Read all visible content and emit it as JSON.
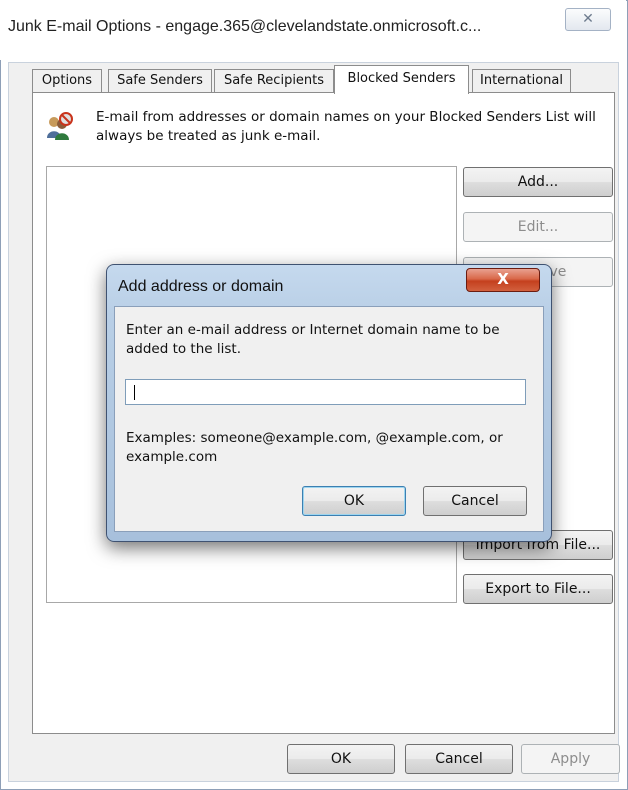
{
  "window": {
    "title": "Junk E-mail Options - engage.365@clevelandstate.onmicrosoft.c...",
    "close_glyph": "✕"
  },
  "tabs": [
    {
      "label": "Options",
      "active": false
    },
    {
      "label": "Safe Senders",
      "active": false
    },
    {
      "label": "Safe Recipients",
      "active": false
    },
    {
      "label": "Blocked Senders",
      "active": true
    },
    {
      "label": "International",
      "active": false
    }
  ],
  "blocked_senders": {
    "description": "E-mail from addresses or domain names on your Blocked Senders List will always be treated as junk e-mail.",
    "icon": "blocked-users-icon",
    "list_items": [],
    "buttons": {
      "add": "Add...",
      "edit": "Edit...",
      "remove": "Remove",
      "import": "Import from File...",
      "export": "Export to File..."
    }
  },
  "footer": {
    "ok": "OK",
    "cancel": "Cancel",
    "apply": "Apply"
  },
  "dialog": {
    "title": "Add address or domain",
    "close_glyph": "X",
    "prompt": "Enter an e-mail address or Internet domain name to be added to the list.",
    "input_value": "",
    "examples": "Examples: someone@example.com, @example.com, or example.com",
    "ok": "OK",
    "cancel": "Cancel"
  },
  "colors": {
    "dialog_frame": "#b9cfe6",
    "dialog_close": "#c4401e",
    "default_button_border": "#3c7fb1"
  }
}
